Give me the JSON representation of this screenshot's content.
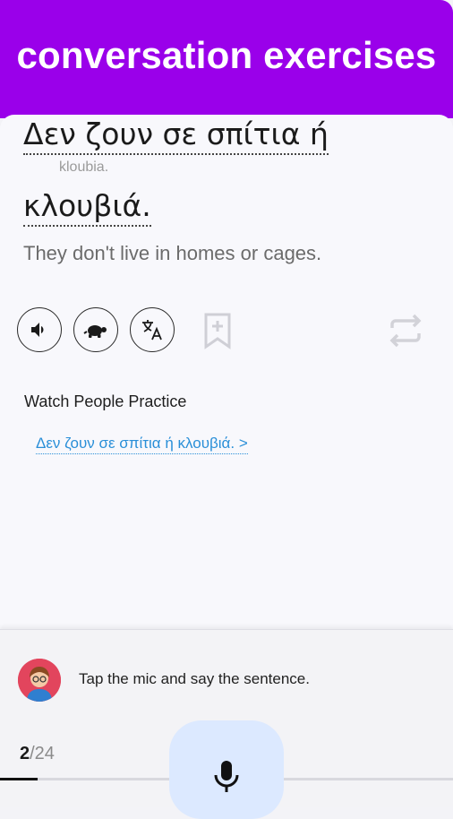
{
  "header": {
    "title": "conversation exercises"
  },
  "sentence": {
    "line1": "Δεν ζουν σε σπίτια ή",
    "transliteration": "kloubia.",
    "line2": "κλουβιά.",
    "translation": "They don't live in homes or cages."
  },
  "actions": {
    "audio_icon": "speaker-icon",
    "slow_icon": "turtle-icon",
    "translate_icon": "translate-icon",
    "bookmark_icon": "bookmark-add-icon",
    "repeat_icon": "repeat-icon"
  },
  "watch": {
    "label": "Watch People Practice",
    "link": "Δεν ζουν σε σπίτια ή κλουβιά. >"
  },
  "bottom": {
    "tip": "Tap the mic and say the sentence.",
    "progress_current": "2",
    "progress_total": "/24",
    "progress_fraction": 0.083,
    "mic_icon": "microphone-icon"
  },
  "colors": {
    "header": "#9a00ea",
    "link": "#2a8fd8",
    "mic_bg": "#dce9ff"
  }
}
